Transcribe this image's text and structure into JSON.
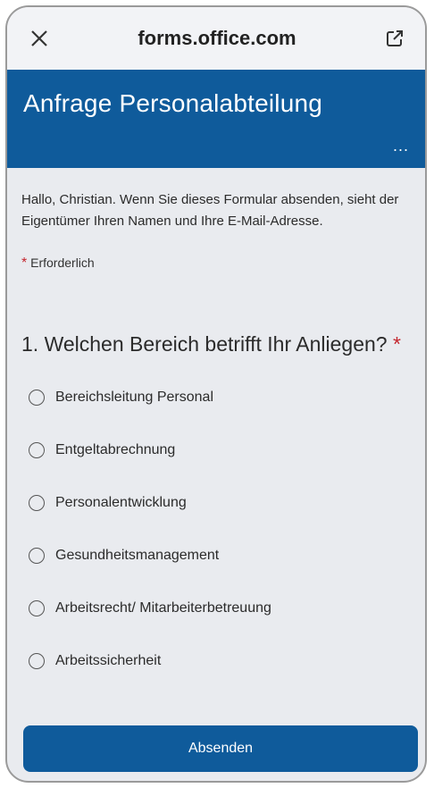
{
  "browser": {
    "url": "forms.office.com",
    "close_icon": "close-icon",
    "open_external_icon": "open-external-icon"
  },
  "form": {
    "title": "Anfrage Personalabteilung",
    "more_label": "...",
    "intro": "Hallo, Christian. Wenn Sie dieses Formular absenden, sieht der Eigentümer Ihren Namen und Ihre E-Mail-Adresse.",
    "required_star": "*",
    "required_label": "Erforderlich",
    "question": {
      "number_and_text": "1. Welchen Bereich betrifft Ihr Anliegen?",
      "required_star": "*",
      "options": [
        "Bereichsleitung Personal",
        "Entgeltabrechnung",
        "Personalentwicklung",
        "Gesundheitsmanagement",
        "Arbeitsrecht/ Mitarbeiterbetreuung",
        "Arbeitssicherheit"
      ]
    },
    "submit_label": "Absenden"
  },
  "colors": {
    "accent": "#0f5b9b",
    "background": "#e9ebef",
    "required": "#c4262e"
  }
}
